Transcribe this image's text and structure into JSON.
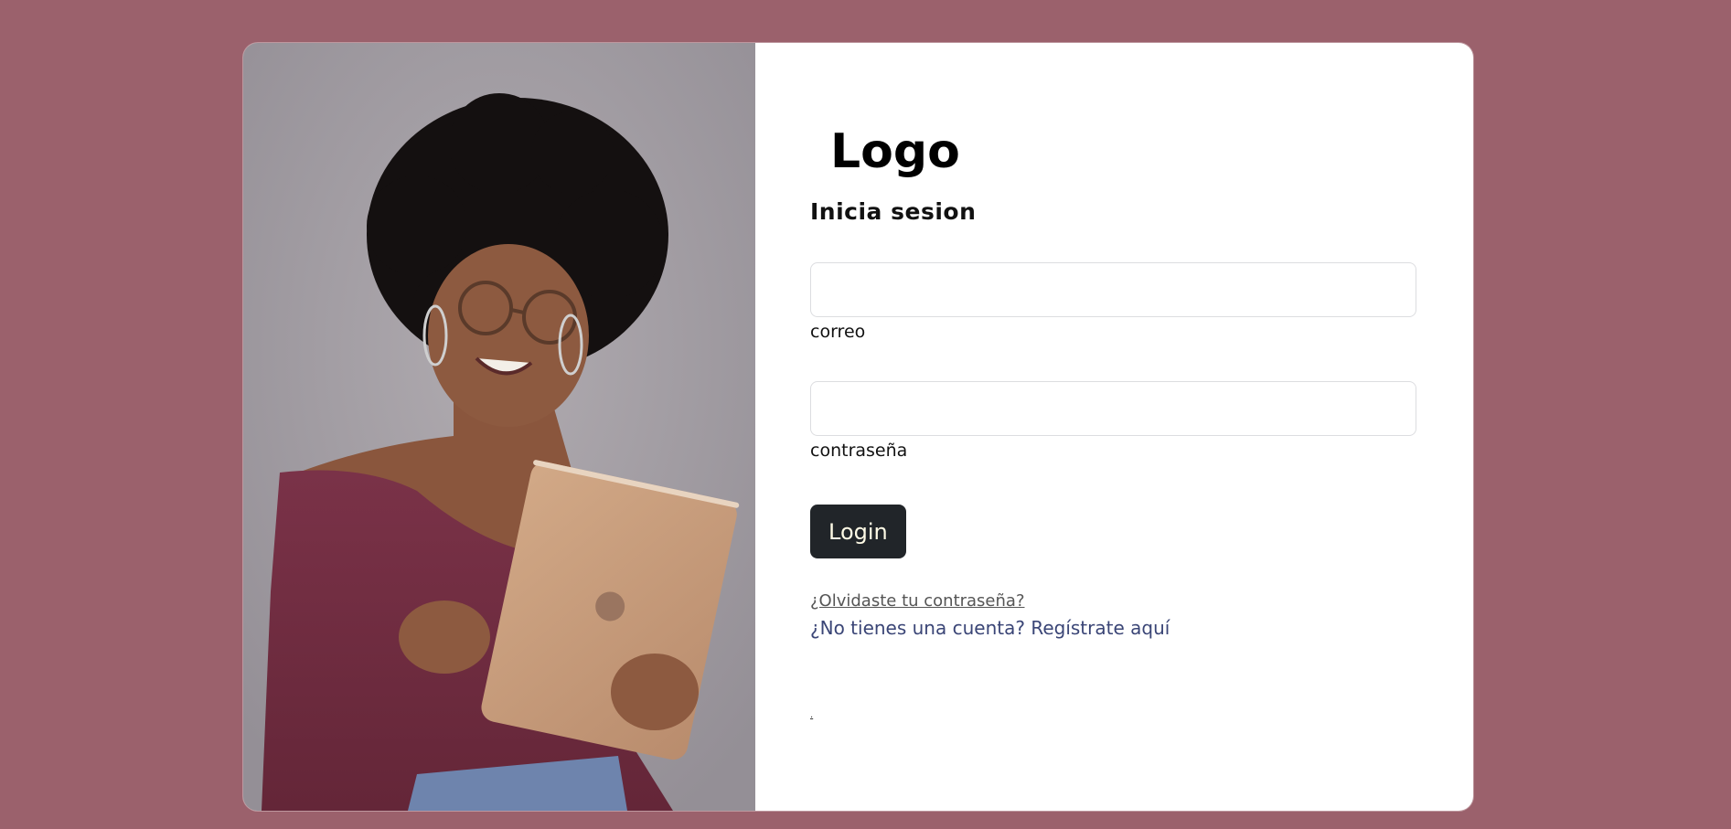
{
  "logo": {
    "text": "Logo"
  },
  "form": {
    "subtitle": "Inicia sesion",
    "email": {
      "label": "correo",
      "value": "",
      "placeholder": ""
    },
    "password": {
      "label": "contraseña",
      "value": "",
      "placeholder": ""
    },
    "login_label": "Login",
    "forgot_link": "¿Olvidaste tu contraseña?",
    "register_link": "¿No tienes una cuenta? Regístrate aquí",
    "tiny_link": "."
  },
  "colors": {
    "page_background": "#9b616c",
    "card_background": "#ffffff",
    "button_background": "#212529",
    "button_text": "#fffbe6",
    "register_link": "#3a4576"
  },
  "icons": {
    "hero_image": "woman-with-tablet-photo"
  }
}
